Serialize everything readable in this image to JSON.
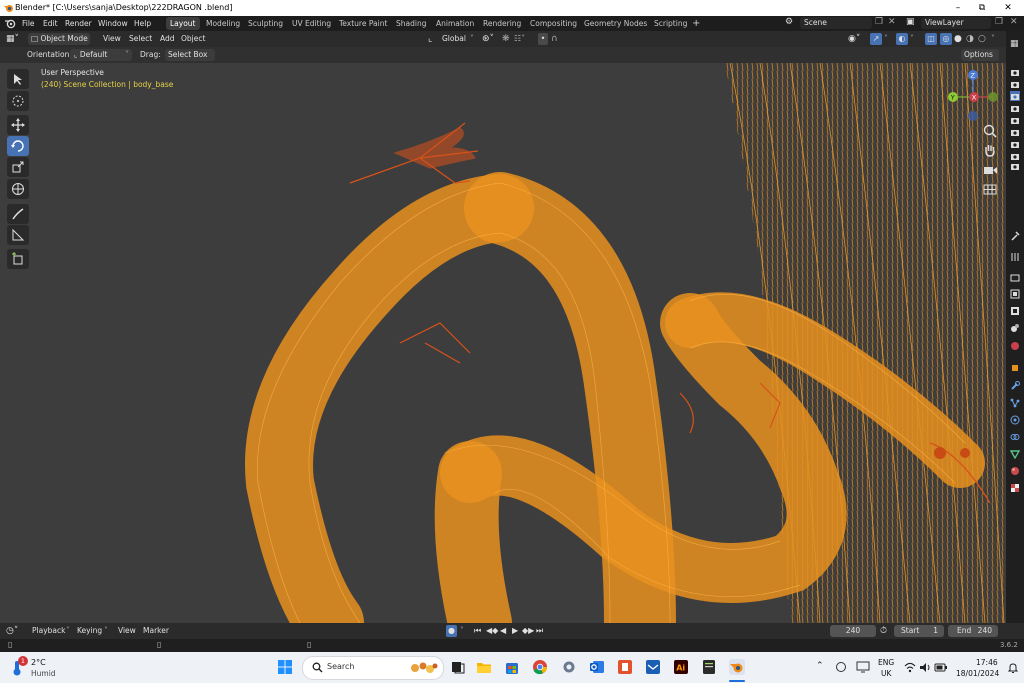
{
  "titlebar": {
    "title": "Blender* [C:\\Users\\sanja\\Desktop\\222DRAGON .blend]"
  },
  "menu": {
    "items": [
      "File",
      "Edit",
      "Render",
      "Window",
      "Help"
    ]
  },
  "workspaces": [
    "Layout",
    "Modeling",
    "Sculpting",
    "UV Editing",
    "Texture Paint",
    "Shading",
    "Animation",
    "Rendering",
    "Compositing",
    "Geometry Nodes",
    "Scripting"
  ],
  "workspace_add": "+",
  "scene": {
    "label": "Scene"
  },
  "view_layer": {
    "label": "ViewLayer"
  },
  "header": {
    "mode": "Object Mode",
    "view": "View",
    "select": "Select",
    "add": "Add",
    "object": "Object",
    "transform": "Global"
  },
  "header2": {
    "orientation_label": "Orientation:",
    "orientation_value": "Default",
    "drag_label": "Drag:",
    "drag_value": "Select Box",
    "options": "Options"
  },
  "viewport": {
    "perspective": "User Perspective",
    "collection": "(240) Scene Collection | body_base"
  },
  "gizmo": {
    "z": "Z",
    "y": "Y",
    "x": "X"
  },
  "timeline": {
    "playback": "Playback",
    "keying": "Keying",
    "view": "View",
    "marker": "Marker",
    "current_frame": "240",
    "start_label": "Start",
    "start_value": "1",
    "end_label": "End",
    "end_value": "240"
  },
  "status": {
    "version": "3.6.2"
  },
  "taskbar": {
    "weather_temp": "2°C",
    "weather_text": "Humid",
    "weather_badge": "1",
    "search_placeholder": "Search",
    "lang": "ENG",
    "region": "UK",
    "time": "17:46",
    "date": "18/01/2024"
  },
  "colors": {
    "accent": "#4772b3",
    "wire": "#e8901f",
    "viewport_bg": "#3d3d3d",
    "collection_text": "#e6d14a"
  }
}
